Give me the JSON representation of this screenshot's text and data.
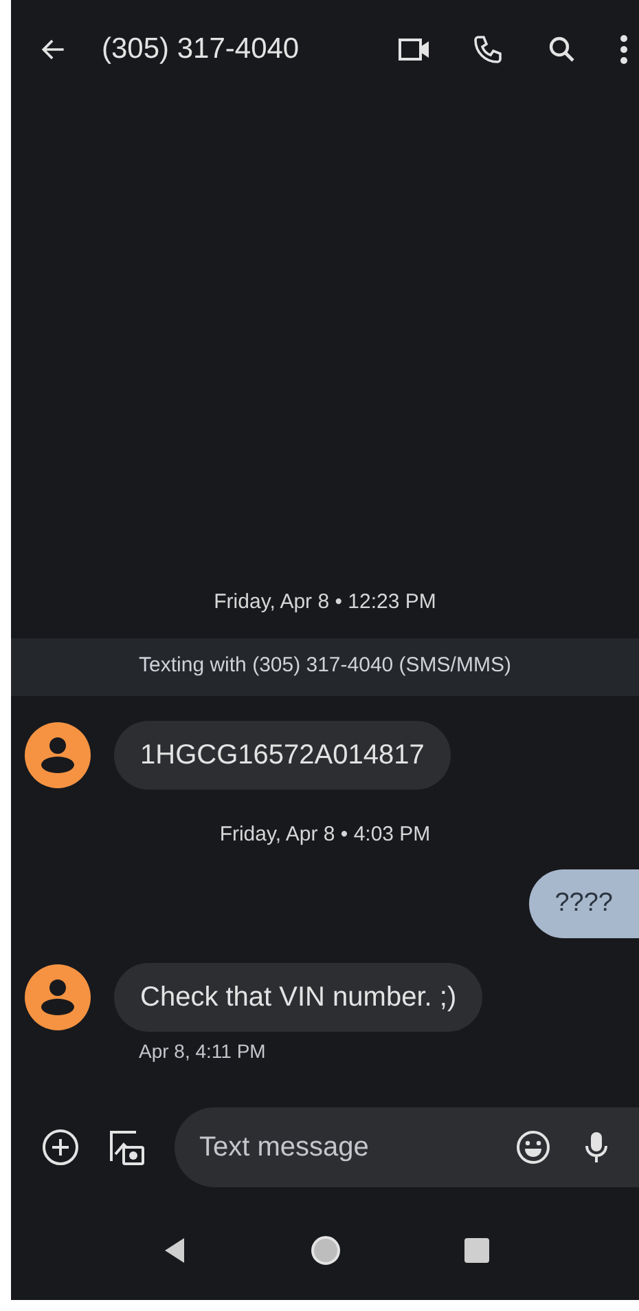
{
  "header": {
    "title": "(305) 317-4040"
  },
  "messages": [
    {
      "kind": "date",
      "text": "Friday, Apr 8 • 12:23 PM"
    },
    {
      "kind": "banner",
      "text": "Texting with (305) 317-4040 (SMS/MMS)"
    },
    {
      "kind": "incoming",
      "text": "1HGCG16572A014817"
    },
    {
      "kind": "date",
      "text": "Friday, Apr 8 • 4:03 PM"
    },
    {
      "kind": "outgoing",
      "text": "????"
    },
    {
      "kind": "incoming",
      "text": "Check that VIN number. ;)",
      "time": "Apr 8, 4:11 PM"
    }
  ],
  "compose": {
    "placeholder": "Text message"
  }
}
